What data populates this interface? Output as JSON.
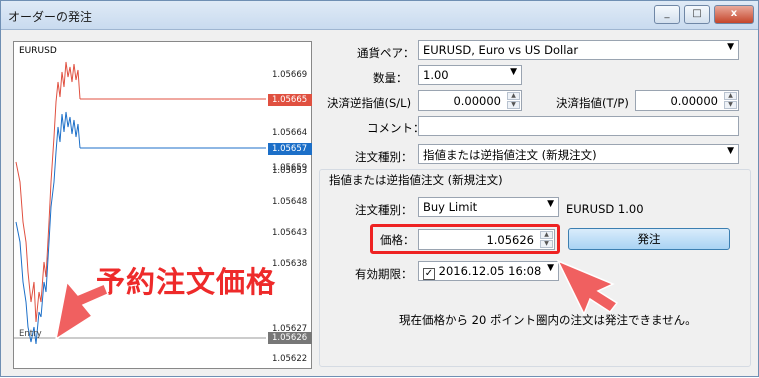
{
  "window": {
    "title": "オーダーの発注",
    "buttons": [
      "_",
      "□",
      "x"
    ]
  },
  "chart": {
    "symbol": "EURUSD",
    "price_labels": [
      "1.05669",
      "1.05664",
      "1.05659",
      "1.05653",
      "1.05648",
      "1.05643",
      "1.05638",
      "1.05627",
      "1.05622"
    ],
    "ask_tag": "1.05665",
    "bid_tag": "1.05657",
    "entry_tag": "1.05626",
    "entry_label": "Entry",
    "colors": {
      "ask": "#e05040",
      "bid": "#1c6fc8",
      "entry": "#888888"
    }
  },
  "form": {
    "symbol_label": "通貨ペア：",
    "symbol_value": "EURUSD, Euro vs US Dollar",
    "volume_label": "数量：",
    "volume_value": "1.00",
    "sl_label": "決済逆指値(S/L)",
    "sl_value": "0.00000",
    "tp_label": "決済指値(T/P)",
    "tp_value": "0.00000",
    "comment_label": "コメント：",
    "comment_value": "",
    "order_type_label": "注文種別：",
    "order_type_value": "指値または逆指値注文 (新規注文)"
  },
  "pending": {
    "group_title": "指値または逆指値注文 (新規注文)",
    "type_label": "注文種別：",
    "type_value": "Buy Limit",
    "symbol_info": "EURUSD 1.00",
    "price_label": "価格：",
    "price_value": "1.05626",
    "place_button": "発注",
    "expiry_label": "有効期限：",
    "expiry_value": "2016.12.05 16:08",
    "expiry_checked": "✓",
    "message": "現在価格から 20 ポイント圏内の注文は発注できません。"
  },
  "annotation": {
    "text": "予約注文価格",
    "color": "#ee2a2a"
  }
}
